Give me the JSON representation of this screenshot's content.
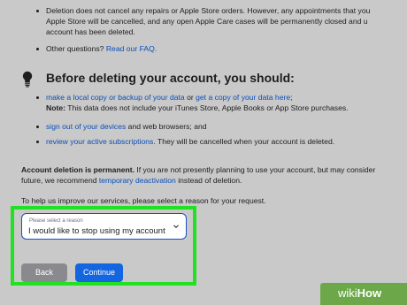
{
  "top_bullets": [
    {
      "line1": "Deletion does not cancel any repairs or Apple Store orders. However, any appointments that you",
      "line2": "Apple Store will be cancelled, and any open Apple Care cases will be permanently closed and u",
      "line3": "account has been deleted."
    },
    {
      "text": "Other questions?",
      "link": "Read our FAQ."
    }
  ],
  "section": {
    "icon": "lightbulb-icon",
    "heading": "Before deleting your account, you should:",
    "items": [
      {
        "link1": "make a local copy or backup of your data",
        "mid": " or ",
        "link2": "get a copy of your data here",
        "end": ";",
        "note_label": "Note:",
        "note_text": " This data does not include your iTunes Store, Apple Books or App Store purchases."
      },
      {
        "link": "sign out of your devices",
        "text": " and web browsers; and"
      },
      {
        "link": "review your active subscriptions",
        "text": ". They will be cancelled when your account is deleted."
      }
    ]
  },
  "permanent": {
    "bold": "Account deletion is permanent.",
    "text": " If you are not presently planning to use your account, but may consider",
    "line2_start": "future, we recommend ",
    "line2_link": "temporary deactivation",
    "line2_end": " instead of deletion."
  },
  "reason_prompt": "To help us improve our services, please select a reason for your request.",
  "reason_select": {
    "label": "Please select a reason",
    "value": "I would like to stop using my account"
  },
  "buttons": {
    "back": "Back",
    "continue": "Continue"
  },
  "watermark": {
    "wiki": "wiki",
    "how": "How"
  },
  "colors": {
    "link": "#0a4fb8",
    "continue": "#1465e0",
    "back": "#8a8a8e",
    "highlight": "#22e022"
  }
}
